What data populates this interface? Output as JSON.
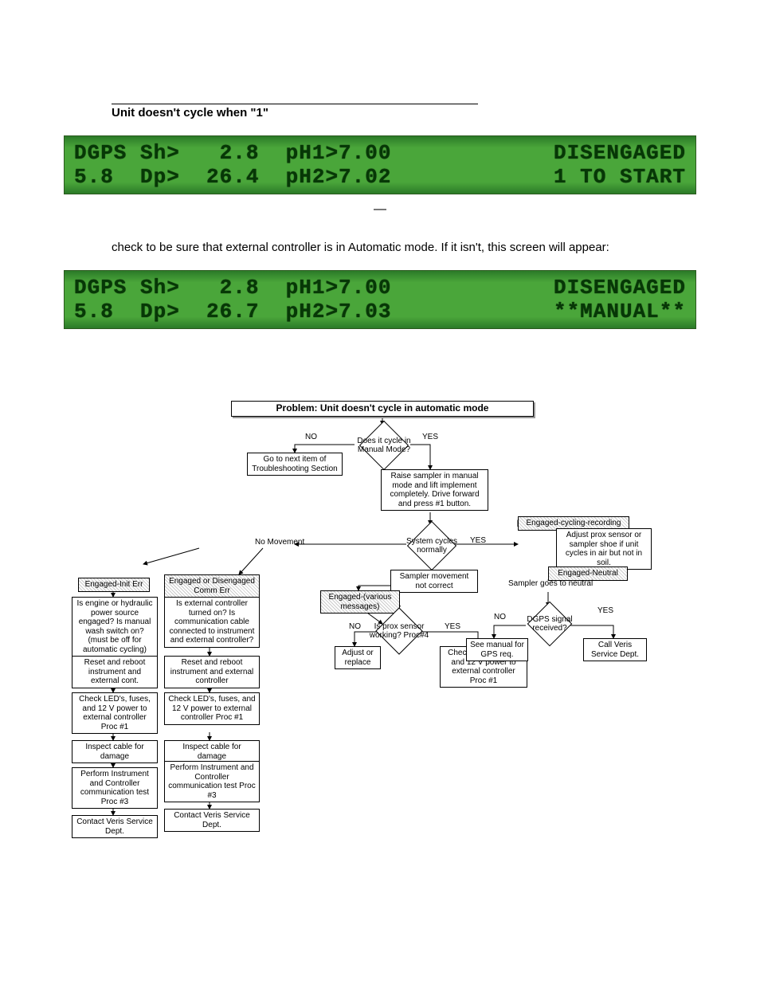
{
  "title": "Unit doesn't cycle when \"1\"",
  "lcd1": {
    "l1": "DGPS Sh>   2.8  pH1>7.00",
    "l2": "5.8  Dp>  26.4  pH2>7.02",
    "r1": "DISENGAGED",
    "r2": "1 TO START"
  },
  "dash": "—",
  "body_text": "check to be sure that external controller is in Automatic mode.  If it isn't, this screen will appear:",
  "lcd2": {
    "l1": "DGPS Sh>   2.8  pH1>7.00",
    "l2": "5.8  Dp>  26.7  pH2>7.03",
    "r1": "DISENGAGED",
    "r2": "**MANUAL**"
  },
  "flow": {
    "problem_title": "Problem:  Unit doesn't cycle in automatic mode",
    "d_cycle_manual": "Does it cycle in Manual Mode?",
    "no": "NO",
    "yes": "YES",
    "goto_next": "Go to next item of Troubleshooting Section",
    "raise_sampler": "Raise sampler in manual mode and lift implement completely. Drive forward and press #1 button.",
    "no_movement": "No Movement",
    "d_system_cycles": "System cycles normally",
    "engaged_cycling": "Engaged-cycling-recording",
    "adjust_prox_air": "Adjust prox sensor or sampler shoe if unit cycles in air but not in soil.",
    "sampler_not_correct": "Sampler movement not correct",
    "engaged_various": "Engaged-(various messages)",
    "engaged_neutral": "Engaged-Neutral",
    "sampler_neutral": "Sampler goes to neutral",
    "engaged_init": "Engaged-Init Err",
    "engaged_comm": "Engaged or Disengaged Comm Err",
    "d_prox_working": "Is prox sensor working? Proc#4",
    "adjust_replace": "Adjust or replace",
    "is_engine": "Is engine or hydraulic power source engaged? Is manual wash switch on? (must be off for automatic cycling)",
    "is_ext_ctrl": "Is external controller turned on? Is communication cable connected to instrument and external controller?",
    "d_dgps": "DGPS signal received?",
    "see_manual": "See manual for GPS req.",
    "call_veris": "Call Veris Service Dept.",
    "reset_reboot_ext": "Reset and reboot instrument and external cont.",
    "reset_reboot_ctrl": "Reset and reboot instrument and external controller",
    "check_led_1": "Check LED's, fuses, and 12 V power to external controller Proc #1",
    "check_led_2": "Check LED's, fuses, and 12 V power to external controller Proc #1",
    "check_led_sys": "Check LED's, fuses, and 12 V power to external controller Proc #1",
    "inspect_cable": "Inspect cable for damage",
    "inspect_cable2": "Inspect cable for damage",
    "perform_test": "Perform Instrument and Controller communication test Proc #3",
    "perform_test2": "Perform Instrument and Controller communication test Proc #3",
    "contact_veris": "Contact Veris Service Dept.",
    "contact_veris2": "Contact Veris Service Dept."
  }
}
